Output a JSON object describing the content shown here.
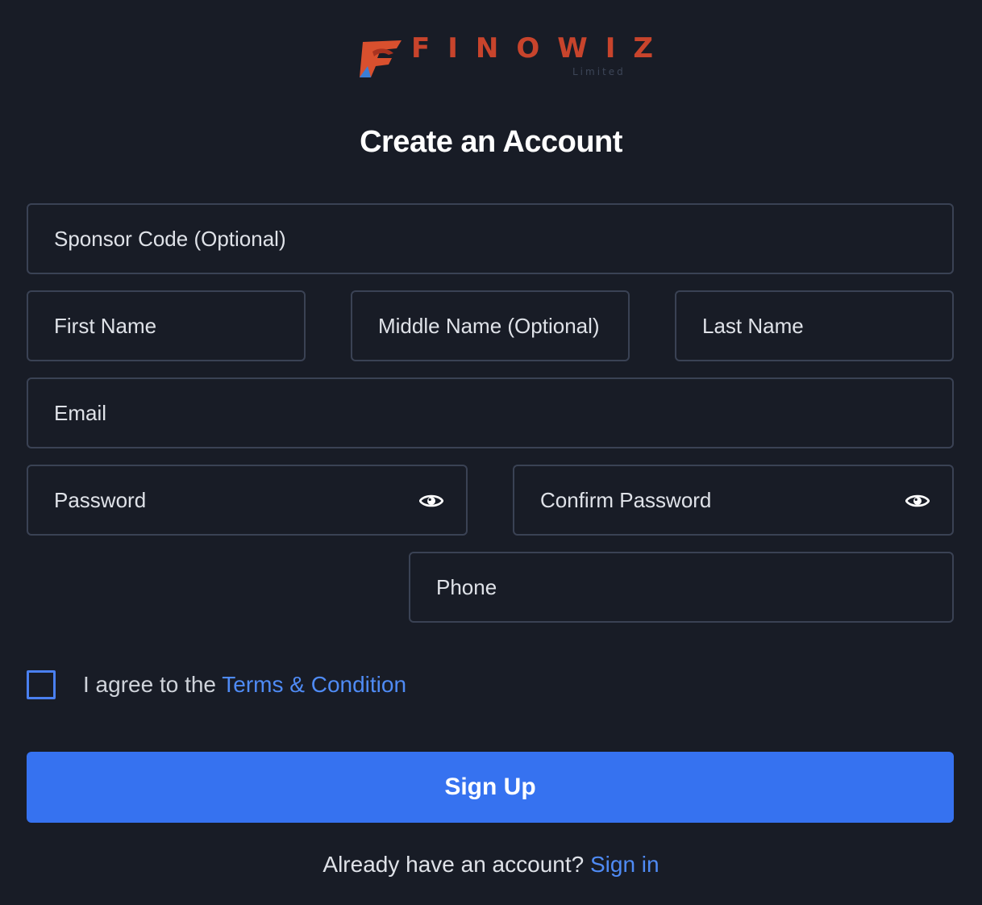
{
  "brand": {
    "name": "FINOWIZ",
    "suffix": "Limited",
    "primary_color": "#c8442c",
    "accent_color": "#3672f0",
    "link_color": "#4f8bf5",
    "background_color": "#181c26"
  },
  "header": {
    "title": "Create an Account"
  },
  "form": {
    "sponsor_code": {
      "placeholder": "Sponsor Code (Optional)",
      "value": ""
    },
    "first_name": {
      "placeholder": "First Name",
      "value": ""
    },
    "middle_name": {
      "placeholder": "Middle Name (Optional)",
      "value": ""
    },
    "last_name": {
      "placeholder": "Last Name",
      "value": ""
    },
    "email": {
      "placeholder": "Email",
      "value": ""
    },
    "password": {
      "placeholder": "Password",
      "value": "",
      "toggle_icon": "eye-icon"
    },
    "confirm_password": {
      "placeholder": "Confirm Password",
      "value": "",
      "toggle_icon": "eye-icon"
    },
    "phone": {
      "placeholder": "Phone",
      "value": ""
    }
  },
  "agreement": {
    "checked": false,
    "text": "I agree to the ",
    "link_label": "Terms & Condition"
  },
  "actions": {
    "submit_label": "Sign Up"
  },
  "footer": {
    "prompt": "Already have an account? ",
    "link_label": "Sign in"
  }
}
